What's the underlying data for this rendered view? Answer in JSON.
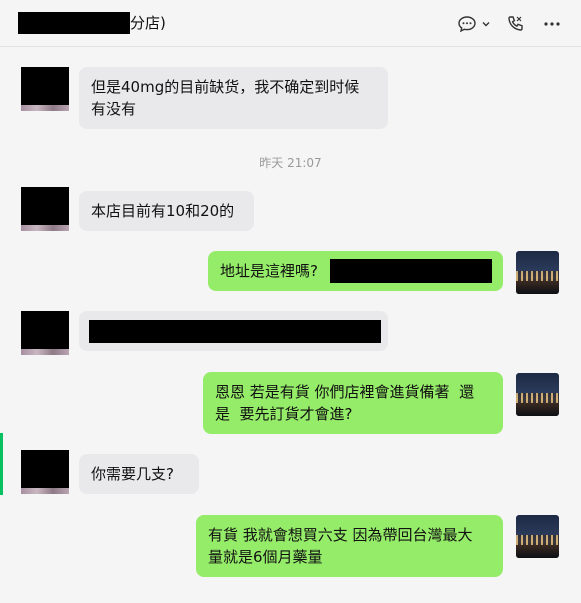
{
  "header": {
    "title_suffix": "分店)",
    "icons": [
      "chat-bubble-icon",
      "chevron-down-icon",
      "call-icon",
      "more-icon"
    ]
  },
  "messages": [
    {
      "side": "in",
      "lines": [
        "但是40mg的目前缺货，我不确定到时候",
        "有没有"
      ]
    },
    {
      "side": "in",
      "lines": [
        "本店目前有10和20的"
      ]
    },
    {
      "side": "out",
      "lines": [
        "地址是這裡嗎?"
      ]
    },
    {
      "side": "in",
      "lines": [
        ""
      ]
    },
    {
      "side": "out",
      "lines": [
        "恩恩 若是有貨 你們店裡會進貨備著  還",
        "是  要先訂貨才會進?"
      ]
    },
    {
      "side": "in",
      "lines": [
        "你需要几支?"
      ]
    },
    {
      "side": "out",
      "lines": [
        "有貨 我就會想買六支 因為帶回台灣最大",
        "量就是6個月藥量"
      ]
    }
  ],
  "timestamp": "昨天 21:07",
  "colors": {
    "incoming_bubble": "#e9e9eb",
    "outgoing_bubble": "#95ec69",
    "background": "#f5f5f5"
  }
}
